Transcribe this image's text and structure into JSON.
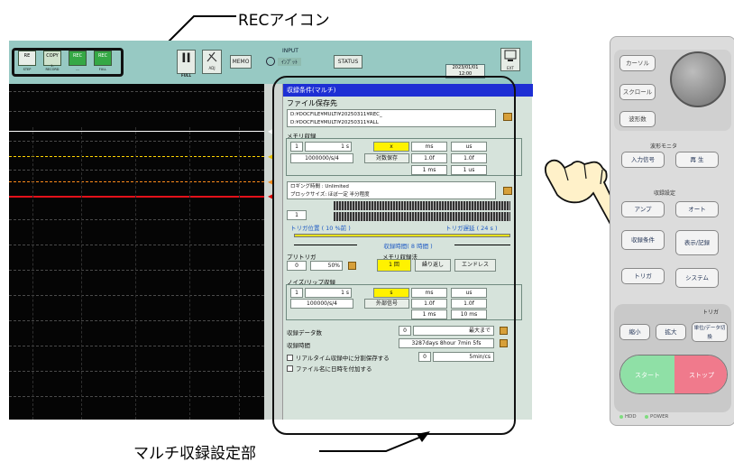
{
  "callouts": {
    "rec_icon": "RECアイコン",
    "multi_setting": "マルチ収録設定部"
  },
  "toolbar": {
    "rec_icons": [
      {
        "glyph": "RE",
        "label": "STEP"
      },
      {
        "glyph": "COPY",
        "label": "1-RECORD"
      },
      {
        "glyph": "REC",
        "label": "---"
      },
      {
        "glyph": "REC",
        "label": "FULL"
      }
    ],
    "pause_glyph": "II",
    "pause_sub": "FULL",
    "pen_sub": "ADJ",
    "cursor_label": "MEMO",
    "input_label": "INPUT",
    "input_val": "ｲﾝﾌﾟｯﾄ",
    "status_label": "STATUS",
    "time_top": "2023/01/01",
    "time_bottom": "12:00",
    "monitor_sub": "EXT"
  },
  "panel": {
    "title": "収録条件(マルチ)",
    "file": {
      "label": "ファイル保存先",
      "path1": "D:¥DOCFILE¥MULTI¥20250311¥REC_",
      "path2": "D:¥DOCFILE¥MULTI¥20250311¥ALL"
    },
    "mem_section": {
      "label": "メモリ収録",
      "n": "1",
      "x1": "1 s",
      "xopt": "x",
      "c1": "ms",
      "c2": "us",
      "rate": "1000000/s/4",
      "mode": "対数保存",
      "v1": "1.0f",
      "v2": "1.0f",
      "u1": "1 ms",
      "u2": "1 us"
    },
    "info": {
      "line1": "ロギング時間  :  Unlimited",
      "line2": "ブロックサイズ:  ほぼ一定  半分程度"
    },
    "trigger": {
      "n": "1",
      "pre": "トリガ位置 ( 10 %前 )",
      "post": "トリガ遅延 ( 24 s )",
      "center": "収録時間( 8 時間 )"
    },
    "pre_trigger": {
      "label": "プリトリガ",
      "n": "0",
      "pct": "50%"
    },
    "mem_method": {
      "label": "メモリ収録法",
      "opts": [
        "1 回",
        "繰り返し",
        "エンドレス"
      ]
    },
    "wave": {
      "label": "ノイズ/リップ収録",
      "n": "1",
      "x1": "1 s",
      "xopt": "s",
      "c1": "ms",
      "c2": "us",
      "rate": "100000/s/4",
      "mode": "外部信号",
      "v1": "1.0f",
      "v2": "1.0f",
      "u1": "1 ms",
      "u2": "10 ms"
    },
    "record_count": {
      "label": "収録データ数",
      "n": "0",
      "right": "最大まで"
    },
    "record_time": {
      "label": "収録時間",
      "value": "3287days 8hour  7min 5fs"
    },
    "checks": [
      "リアルタイム収録中に分割保存する",
      "ファイル名に日時を付加する"
    ],
    "check_extra_n": "0",
    "check_extra_v": "5min/cs"
  },
  "hardware": {
    "knob_labels": [
      "カーソル",
      "スクロール",
      "波形数"
    ],
    "monitor": "波形モニタ",
    "input_btn": "入力信号",
    "play_btn": "再 生",
    "record_setting": "収録設定",
    "btn_amp": "アンプ",
    "btn_auto": "オート",
    "btn_cond": "収録条件",
    "btn_disp": "表示/記録",
    "btn_trig": "トリガ",
    "btn_sys": "システム",
    "trig_label": "トリガ",
    "btn_a": "縮小",
    "btn_b": "拡大",
    "btn_c": "単位/データ切換",
    "start": "スタート",
    "stop": "ストップ",
    "leds": [
      "HDD",
      "POWER"
    ]
  }
}
